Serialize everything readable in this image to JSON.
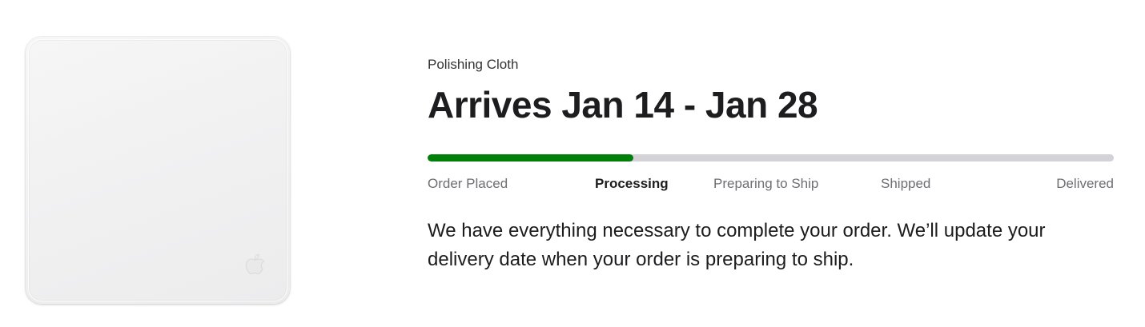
{
  "product": {
    "name": "Polishing Cloth",
    "image_icon": "polishing-cloth-image",
    "logo_icon": "apple-logo-icon"
  },
  "order": {
    "arrival": "Arrives Jan 14 - Jan 28",
    "progress_fraction": 0.3,
    "progress_color": "#008009",
    "track_color": "#d2d2d7",
    "steps": [
      {
        "label": "Order Placed",
        "state": "complete"
      },
      {
        "label": "Processing",
        "state": "current"
      },
      {
        "label": "Preparing to Ship",
        "state": "upcoming"
      },
      {
        "label": "Shipped",
        "state": "upcoming"
      },
      {
        "label": "Delivered",
        "state": "upcoming"
      }
    ],
    "message": "We have everything necessary to complete your order. We’ll update your delivery date when your order is preparing to ship."
  }
}
